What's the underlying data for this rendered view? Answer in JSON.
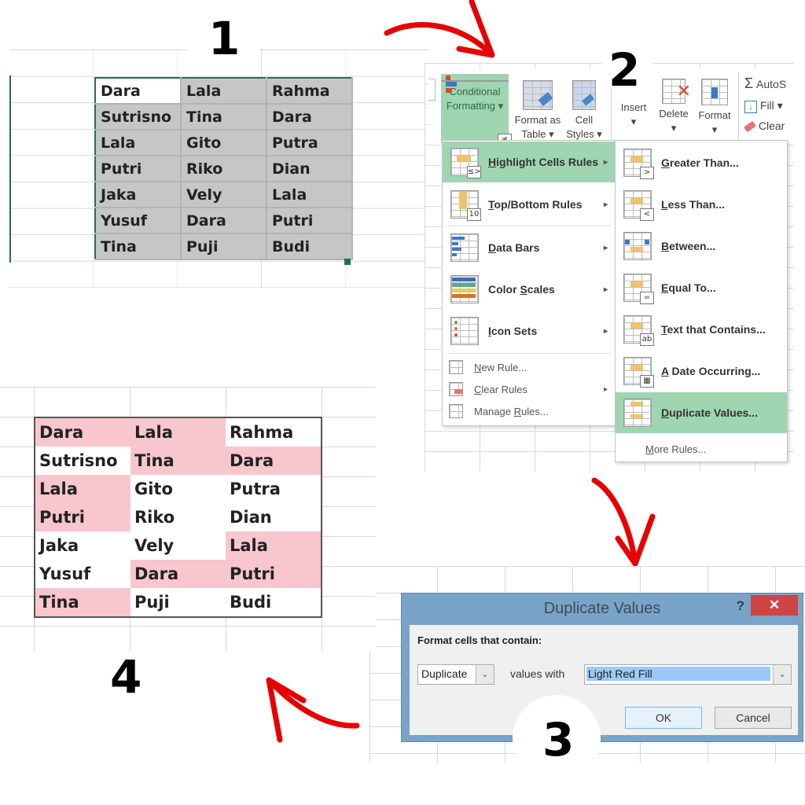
{
  "steps": [
    "1",
    "2",
    "3",
    "4"
  ],
  "panel1": {
    "rows": [
      [
        "Dara",
        "Lala",
        "Rahma"
      ],
      [
        "Sutrisno",
        "Tina",
        "Dara"
      ],
      [
        "Lala",
        "Gito",
        "Putra"
      ],
      [
        "Putri",
        "Riko",
        "Dian"
      ],
      [
        "Jaka",
        "Vely",
        "Lala"
      ],
      [
        "Yusuf",
        "Dara",
        "Putri"
      ],
      [
        "Tina",
        "Puji",
        "Budi"
      ]
    ],
    "selection_color": "#217346",
    "selected_fill": "#c6c6c6"
  },
  "ribbon": {
    "conditional_formatting": {
      "line1": "Conditional",
      "line2": "Formatting ▾"
    },
    "format_as_table": {
      "line1": "Format as",
      "line2": "Table ▾"
    },
    "cell_styles": {
      "line1": "Cell",
      "line2": "Styles ▾"
    },
    "insert": {
      "line1": "Insert",
      "line2": "▾"
    },
    "delete": {
      "line1": "Delete",
      "line2": "▾"
    },
    "format": {
      "line1": "Format",
      "line2": "▾"
    },
    "autosum": "AutoS",
    "fill": "Fill ▾",
    "clear": "Clear",
    "highlight_color": "#9fd5b1"
  },
  "cf_menu": {
    "items": [
      {
        "label": "Highlight Cells Rules",
        "accel": "H",
        "rest": "ighlight Cells Rules",
        "submenu": true,
        "selected": true
      },
      {
        "label": "Top/Bottom Rules",
        "accel": "T",
        "rest": "op/Bottom Rules",
        "submenu": true
      },
      {
        "label": "Data Bars",
        "accel": "D",
        "rest": "ata Bars",
        "submenu": true
      },
      {
        "label": "Color Scales",
        "pre": "Color ",
        "accel": "S",
        "rest": "cales",
        "submenu": true
      },
      {
        "label": "Icon Sets",
        "accel": "I",
        "rest": "con Sets",
        "submenu": true
      }
    ],
    "small_items": [
      {
        "label": "New Rule...",
        "accel": "N",
        "rest": "ew Rule..."
      },
      {
        "label": "Clear Rules",
        "accel": "C",
        "rest": "lear Rules",
        "submenu": true
      },
      {
        "label": "Manage Rules...",
        "pre": "Manage ",
        "accel": "R",
        "rest": "ules..."
      }
    ],
    "chevron": "▸",
    "badge_top10": "10",
    "badge_ltgt": "≤>"
  },
  "hl_menu": {
    "items": [
      {
        "label": "Greater Than...",
        "accel": "G",
        "rest": "reater Than...",
        "badge": ">"
      },
      {
        "label": "Less Than...",
        "accel": "L",
        "rest": "ess Than...",
        "badge": "<"
      },
      {
        "label": "Between...",
        "accel": "B",
        "rest": "etween...",
        "badge": ""
      },
      {
        "label": "Equal To...",
        "accel": "E",
        "rest": "qual To...",
        "badge": "="
      },
      {
        "label": "Text that Contains...",
        "accel": "T",
        "rest": "ext that Contains...",
        "badge": "ab"
      },
      {
        "label": "A Date Occurring...",
        "accel": "A",
        "rest": " Date Occurring...",
        "badge": "▦"
      },
      {
        "label": "Duplicate Values...",
        "accel": "D",
        "rest": "uplicate Values...",
        "badge": "",
        "selected": true
      }
    ],
    "more_rules": {
      "label": "More Rules...",
      "accel": "M",
      "rest": "ore Rules..."
    }
  },
  "dialog": {
    "title": "Duplicate Values",
    "help": "?",
    "close": "✕",
    "prompt": "Format cells that contain:",
    "type_value": "Duplicate",
    "values_with": "values with",
    "format_value": "Light Red Fill",
    "ok": "OK",
    "cancel": "Cancel",
    "dropdown_arrow": "⌄"
  },
  "panel4": {
    "rows": [
      [
        "Dara",
        "Lala",
        "Rahma"
      ],
      [
        "Sutrisno",
        "Tina",
        "Dara"
      ],
      [
        "Lala",
        "Gito",
        "Putra"
      ],
      [
        "Putri",
        "Riko",
        "Dian"
      ],
      [
        "Jaka",
        "Vely",
        "Lala"
      ],
      [
        "Yusuf",
        "Dara",
        "Putri"
      ],
      [
        "Tina",
        "Puji",
        "Budi"
      ]
    ],
    "duplicate_fill": "#f8c6cd",
    "duplicates": [
      [
        true,
        true,
        false
      ],
      [
        false,
        true,
        true
      ],
      [
        true,
        false,
        false
      ],
      [
        true,
        false,
        false
      ],
      [
        false,
        false,
        true
      ],
      [
        false,
        true,
        true
      ],
      [
        true,
        false,
        false
      ]
    ]
  },
  "arrow_color": "#e60000"
}
